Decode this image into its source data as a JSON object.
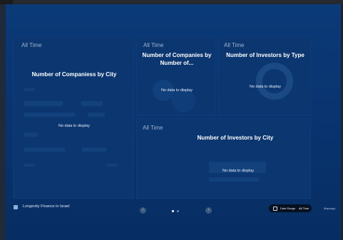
{
  "dashboard": {
    "tiles": [
      {
        "range": "All Time",
        "title": "Number of Companiess by City",
        "empty": "No data to display"
      },
      {
        "range": "All Time",
        "title": "Number of Companies by Number of...",
        "empty": "No data to display"
      },
      {
        "range": "All Time",
        "title": "Number of Investors by Type",
        "empty": "No data to display"
      },
      {
        "range": "All Time",
        "title": "Number of Investors by City",
        "empty": "No data to display"
      }
    ]
  },
  "footer": {
    "title": "Longevity Finance in Israel",
    "prev_icon": "chevron-left-icon",
    "next_icon": "chevron-right-icon",
    "date_range_label": "Date Range",
    "date_range_value": "All Time",
    "brand": "Mapsngo"
  },
  "colors": {
    "background": "#0a2f62",
    "tile": "#0b3670",
    "active_dot": "#ffffff",
    "inactive_dot": "#6f86a6"
  }
}
